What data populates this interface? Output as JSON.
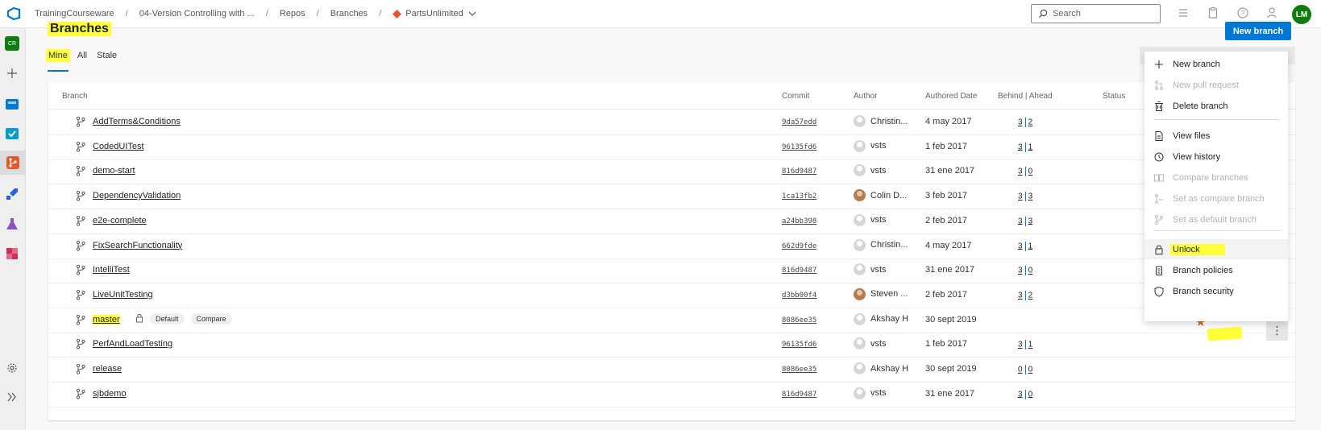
{
  "breadcrumb": {
    "org": "TrainingCourseware",
    "project": "04-Version Controlling with ...",
    "section": "Repos",
    "page": "Branches",
    "repo": "PartsUnlimited"
  },
  "search": {
    "placeholder": "Search"
  },
  "user": {
    "initials": "LM"
  },
  "rail": {
    "project_badge": "CR"
  },
  "page": {
    "title": "Branches",
    "new_branch_label": "New branch",
    "tabs": [
      "Mine",
      "All",
      "Stale"
    ]
  },
  "table": {
    "columns": {
      "branch": "Branch",
      "commit": "Commit",
      "author": "Author",
      "authored_date": "Authored Date",
      "behind_ahead": "Behind | Ahead",
      "status": "Status"
    },
    "rows": [
      {
        "name": "AddTerms&Conditions",
        "commit": "9da57edd",
        "author": "Christin...",
        "date": "4 may 2017",
        "behind": "3",
        "ahead": "2"
      },
      {
        "name": "CodedUITest",
        "commit": "96135fd6",
        "author": "vsts",
        "date": "1 feb 2017",
        "behind": "3",
        "ahead": "1"
      },
      {
        "name": "demo-start",
        "commit": "816d9487",
        "author": "vsts",
        "date": "31 ene 2017",
        "behind": "3",
        "ahead": "0"
      },
      {
        "name": "DependencyValidation",
        "commit": "1ca13fb2",
        "author": "Colin D...",
        "date": "3 feb 2017",
        "behind": "3",
        "ahead": "3"
      },
      {
        "name": "e2e-complete",
        "commit": "a24bb398",
        "author": "vsts",
        "date": "2 feb 2017",
        "behind": "3",
        "ahead": "3"
      },
      {
        "name": "FixSearchFunctionality",
        "commit": "662d9fde",
        "author": "Christin...",
        "date": "4 may 2017",
        "behind": "3",
        "ahead": "1"
      },
      {
        "name": "IntelliTest",
        "commit": "816d9487",
        "author": "vsts",
        "date": "31 ene 2017",
        "behind": "3",
        "ahead": "0"
      },
      {
        "name": "LiveUnitTesting",
        "commit": "d3bb00f4",
        "author": "Steven ...",
        "date": "2 feb 2017",
        "behind": "3",
        "ahead": "2"
      },
      {
        "name": "master",
        "commit": "8086ee35",
        "author": "Akshay H",
        "date": "30 sept 2019",
        "behind": "",
        "ahead": "",
        "tags": [
          "Default",
          "Compare"
        ]
      },
      {
        "name": "PerfAndLoadTesting",
        "commit": "96135fd6",
        "author": "vsts",
        "date": "1 feb 2017",
        "behind": "3",
        "ahead": "1"
      },
      {
        "name": "release",
        "commit": "8086ee35",
        "author": "Akshay H",
        "date": "30 sept 2019",
        "behind": "0",
        "ahead": "0"
      },
      {
        "name": "sjbdemo",
        "commit": "816d9487",
        "author": "vsts",
        "date": "31 ene 2017",
        "behind": "3",
        "ahead": "0"
      }
    ]
  },
  "context_menu": {
    "items": [
      {
        "label": "New branch",
        "icon": "plus-icon",
        "enabled": true
      },
      {
        "label": "New pull request",
        "icon": "pull-request-icon",
        "enabled": false
      },
      {
        "label": "Delete branch",
        "icon": "trash-icon",
        "enabled": true
      },
      {
        "label": "View files",
        "icon": "file-icon",
        "enabled": true
      },
      {
        "label": "View history",
        "icon": "history-icon",
        "enabled": true
      },
      {
        "label": "Compare branches",
        "icon": "compare-icon",
        "enabled": false
      },
      {
        "label": "Set as compare branch",
        "icon": "compare-branch-icon",
        "enabled": false
      },
      {
        "label": "Set as default branch",
        "icon": "branch-icon",
        "enabled": false
      },
      {
        "label": "Unlock",
        "icon": "lock-icon",
        "enabled": true
      },
      {
        "label": "Branch policies",
        "icon": "policy-icon",
        "enabled": true
      },
      {
        "label": "Branch security",
        "icon": "shield-icon",
        "enabled": true
      }
    ]
  },
  "colors": {
    "accent": "#0078d4",
    "highlight": "#ffff3a",
    "star": "#d46a1f"
  }
}
